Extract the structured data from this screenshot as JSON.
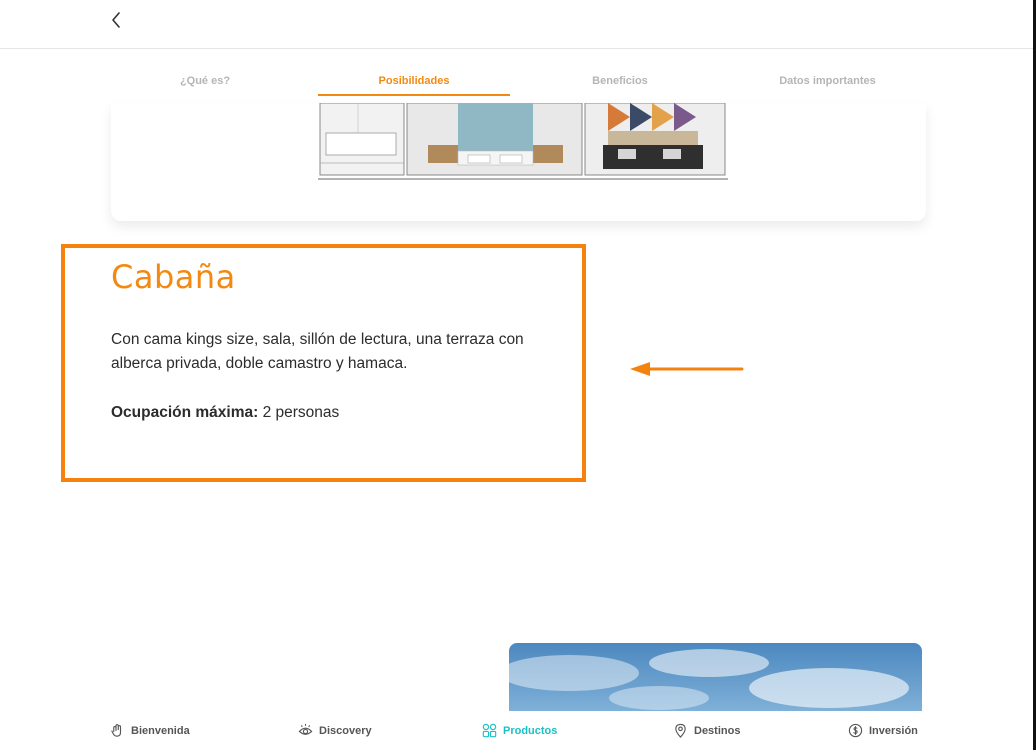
{
  "tabs": [
    {
      "label": "¿Qué es?",
      "active": false
    },
    {
      "label": "Posibilidades",
      "active": true
    },
    {
      "label": "Beneficios",
      "active": false
    },
    {
      "label": "Datos importantes",
      "active": false
    }
  ],
  "room": {
    "title": "Cabaña",
    "description": "Con cama kings size, sala, sillón de lectura, una terraza con alberca privada, doble camastro y hamaca.",
    "occupancy_label": "Ocupación máxima:",
    "occupancy_value": " 2 personas"
  },
  "bottom_nav": [
    {
      "label": "Bienvenida",
      "icon": "hand-wave-icon"
    },
    {
      "label": "Discovery",
      "icon": "eye-icon"
    },
    {
      "label": "Productos",
      "icon": "grid-icon",
      "active": true
    },
    {
      "label": "Destinos",
      "icon": "map-pin-icon"
    },
    {
      "label": "Inversión",
      "icon": "coin-icon"
    }
  ],
  "colors": {
    "accent_orange": "#f28a12",
    "highlight_border": "#f5820f",
    "active_nav": "#18c1c7",
    "tab_inactive": "#b5b5b5"
  }
}
